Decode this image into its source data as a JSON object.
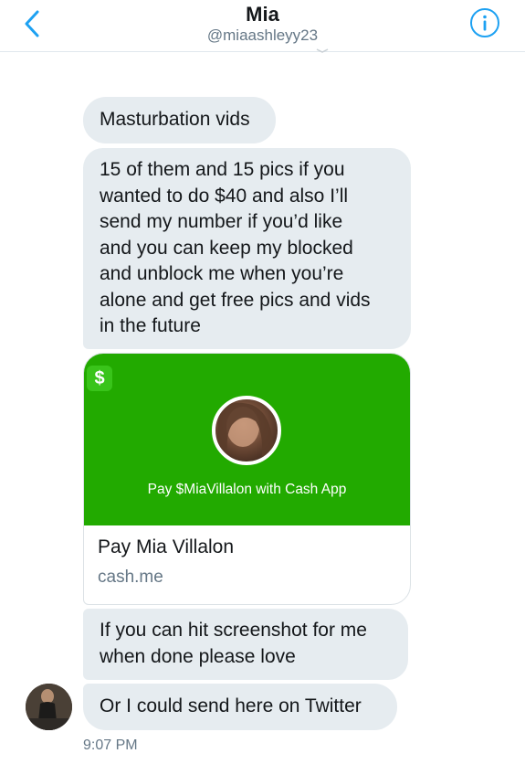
{
  "header": {
    "title": "Mia",
    "handle": "@miaashleyy23",
    "back_icon": "chevron-left-icon",
    "info_icon": "info-icon",
    "accent_color": "#1da1f2"
  },
  "messages": [
    {
      "text": "Masturbation vids"
    },
    {
      "text": "15 of them and 15 pics if you\nwanted to do $40 and also I’ll\nsend my number if you’d like\nand you can keep my blocked\nand unblock me when you’re\nalone and get free pics and vids\nin the future"
    },
    {
      "text": "If you can hit screenshot for me\nwhen done please love"
    },
    {
      "text": "Or I could send here on Twitter"
    }
  ],
  "payment_card": {
    "logo_symbol": "$",
    "pay_label": "Pay $MiaVillalon with Cash App",
    "title": "Pay Mia Villalon",
    "domain": "cash.me",
    "brand_color": "#22aa00"
  },
  "timestamp": "9:07 PM"
}
